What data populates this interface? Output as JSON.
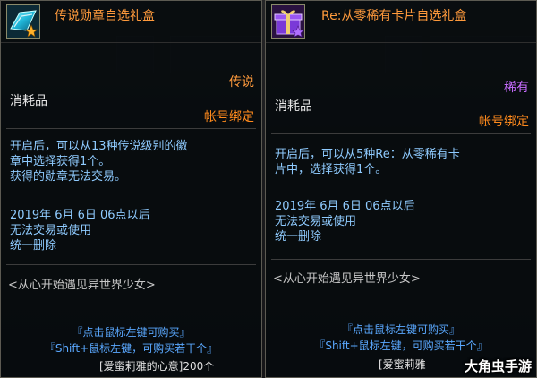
{
  "left": {
    "title": "传说勋章自选礼盒",
    "rarity": "传说",
    "rarity_color": "#ff9a3c",
    "category": "消耗品",
    "bind": "帐号绑定",
    "description": [
      "开启后，可以从13种传说级别的徽",
      "章中选择获得1个。",
      "获得的勋章无法交易。"
    ],
    "restriction": [
      "2019年 6月 6日 06点以后",
      "无法交易或使用",
      "统一删除"
    ],
    "flavor": "<从心开始遇见异世界少女>",
    "buy_hint_1": "『点击鼠标左键可购买』",
    "buy_hint_2": "『Shift+鼠标左键，可购买若干个』",
    "footer": "[爱蜜莉雅的心意]200个",
    "icon": "cyan-medal-box-icon"
  },
  "right": {
    "title": "Re:从零稀有卡片自选礼盒",
    "rarity": "稀有",
    "rarity_color": "#c86cff",
    "category": "消耗品",
    "bind": "帐号绑定",
    "description": [
      "开启后，可以从5种Re：从零稀有卡",
      "片中，选择获得1个。"
    ],
    "restriction": [
      "2019年 6月 6日 06点以后",
      "无法交易或使用",
      "统一删除"
    ],
    "flavor": "<从心开始遇见异世界少女>",
    "buy_hint_1": "『点击鼠标左键可购买』",
    "buy_hint_2": "『Shift+鼠标左键，可购买若干个』",
    "footer": "[爱蜜莉雅",
    "icon": "purple-gift-box-icon"
  },
  "watermark": "大角虫手游"
}
